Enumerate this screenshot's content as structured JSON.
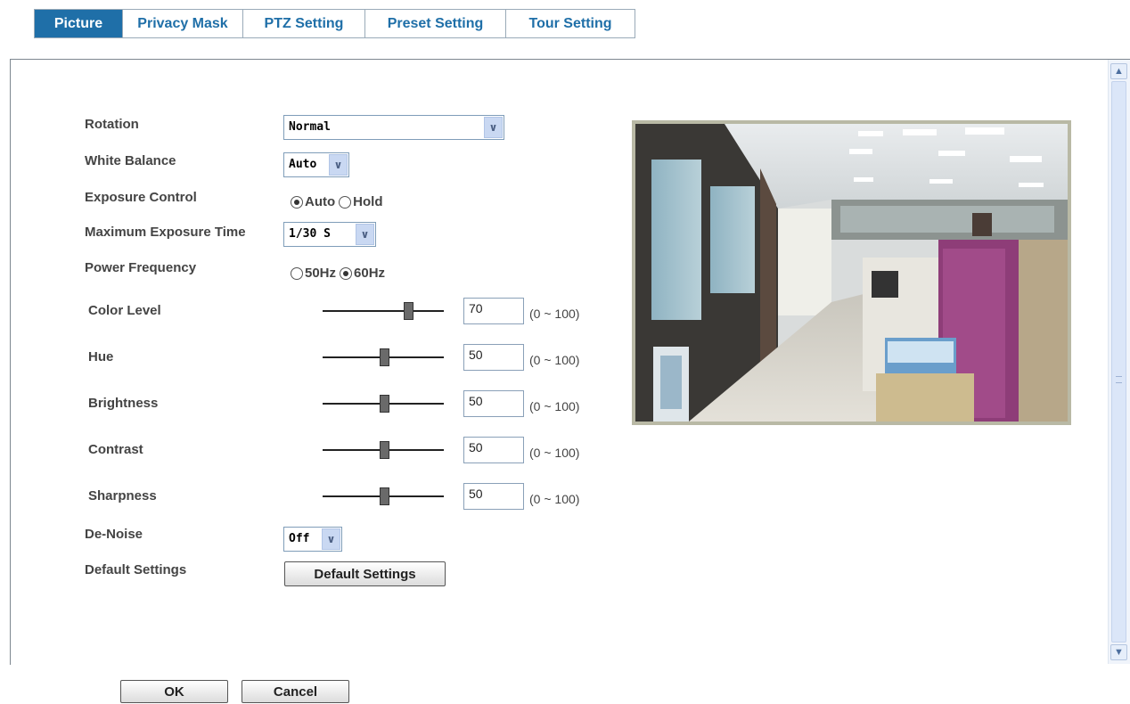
{
  "tabs": [
    {
      "label": "Picture",
      "active": true
    },
    {
      "label": "Privacy Mask"
    },
    {
      "label": "PTZ Setting"
    },
    {
      "label": "Preset Setting"
    },
    {
      "label": "Tour Setting"
    }
  ],
  "settings": {
    "rotation": {
      "label": "Rotation",
      "value": "Normal"
    },
    "white_balance": {
      "label": "White Balance",
      "value": "Auto"
    },
    "exposure_control": {
      "label": "Exposure Control",
      "options": [
        "Auto",
        "Hold"
      ],
      "selected": "Auto"
    },
    "max_exposure_time": {
      "label": "Maximum Exposure Time",
      "value": "1/30 S"
    },
    "power_frequency": {
      "label": "Power Frequency",
      "options": [
        "50Hz",
        "60Hz"
      ],
      "selected": "60Hz"
    },
    "color_level": {
      "label": "Color Level",
      "value": "70",
      "range": "(0 ~ 100)"
    },
    "hue": {
      "label": "Hue",
      "value": "50",
      "range": "(0 ~ 100)"
    },
    "brightness": {
      "label": "Brightness",
      "value": "50",
      "range": "(0 ~ 100)"
    },
    "contrast": {
      "label": "Contrast",
      "value": "50",
      "range": "(0 ~ 100)"
    },
    "sharpness": {
      "label": "Sharpness",
      "value": "50",
      "range": "(0 ~ 100)"
    },
    "de_noise": {
      "label": "De-Noise",
      "value": "Off"
    },
    "default_settings": {
      "label": "Default Settings",
      "button": "Default Settings"
    }
  },
  "footer": {
    "ok": "OK",
    "cancel": "Cancel"
  },
  "icons": {
    "scroll_up": "chevron-up-icon",
    "scroll_down": "chevron-down-icon",
    "dropdown": "chevron-down-icon"
  },
  "colors": {
    "accent": "#1f6fa8",
    "tab_border": "#9aaab8"
  }
}
